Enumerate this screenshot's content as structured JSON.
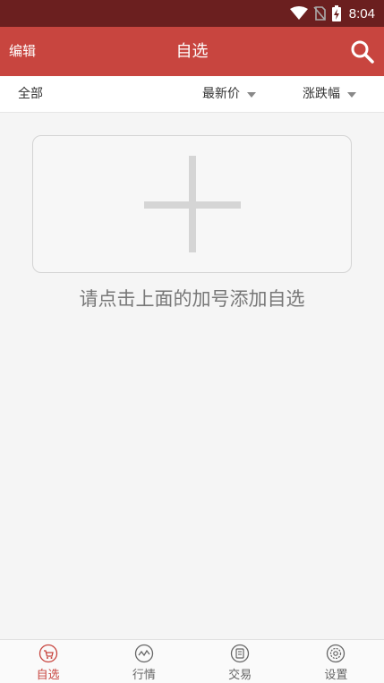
{
  "status_bar": {
    "time": "8:04",
    "icons": [
      "wifi-icon",
      "no-sim-icon",
      "battery-charging-icon"
    ]
  },
  "header": {
    "edit_label": "编辑",
    "title": "自选",
    "search_icon": "search-icon"
  },
  "sort_bar": {
    "all_label": "全部",
    "price_label": "最新价",
    "change_label": "涨跌幅"
  },
  "empty_state": {
    "hint": "请点击上面的加号添加自选"
  },
  "tabs": [
    {
      "label": "自选",
      "icon": "watchlist-icon",
      "active": true
    },
    {
      "label": "行情",
      "icon": "market-icon",
      "active": false
    },
    {
      "label": "交易",
      "icon": "trade-icon",
      "active": false
    },
    {
      "label": "设置",
      "icon": "settings-icon",
      "active": false
    }
  ],
  "colors": {
    "accent": "#c8453f",
    "status_bar": "#6b1f1f",
    "background": "#f5f5f5"
  }
}
